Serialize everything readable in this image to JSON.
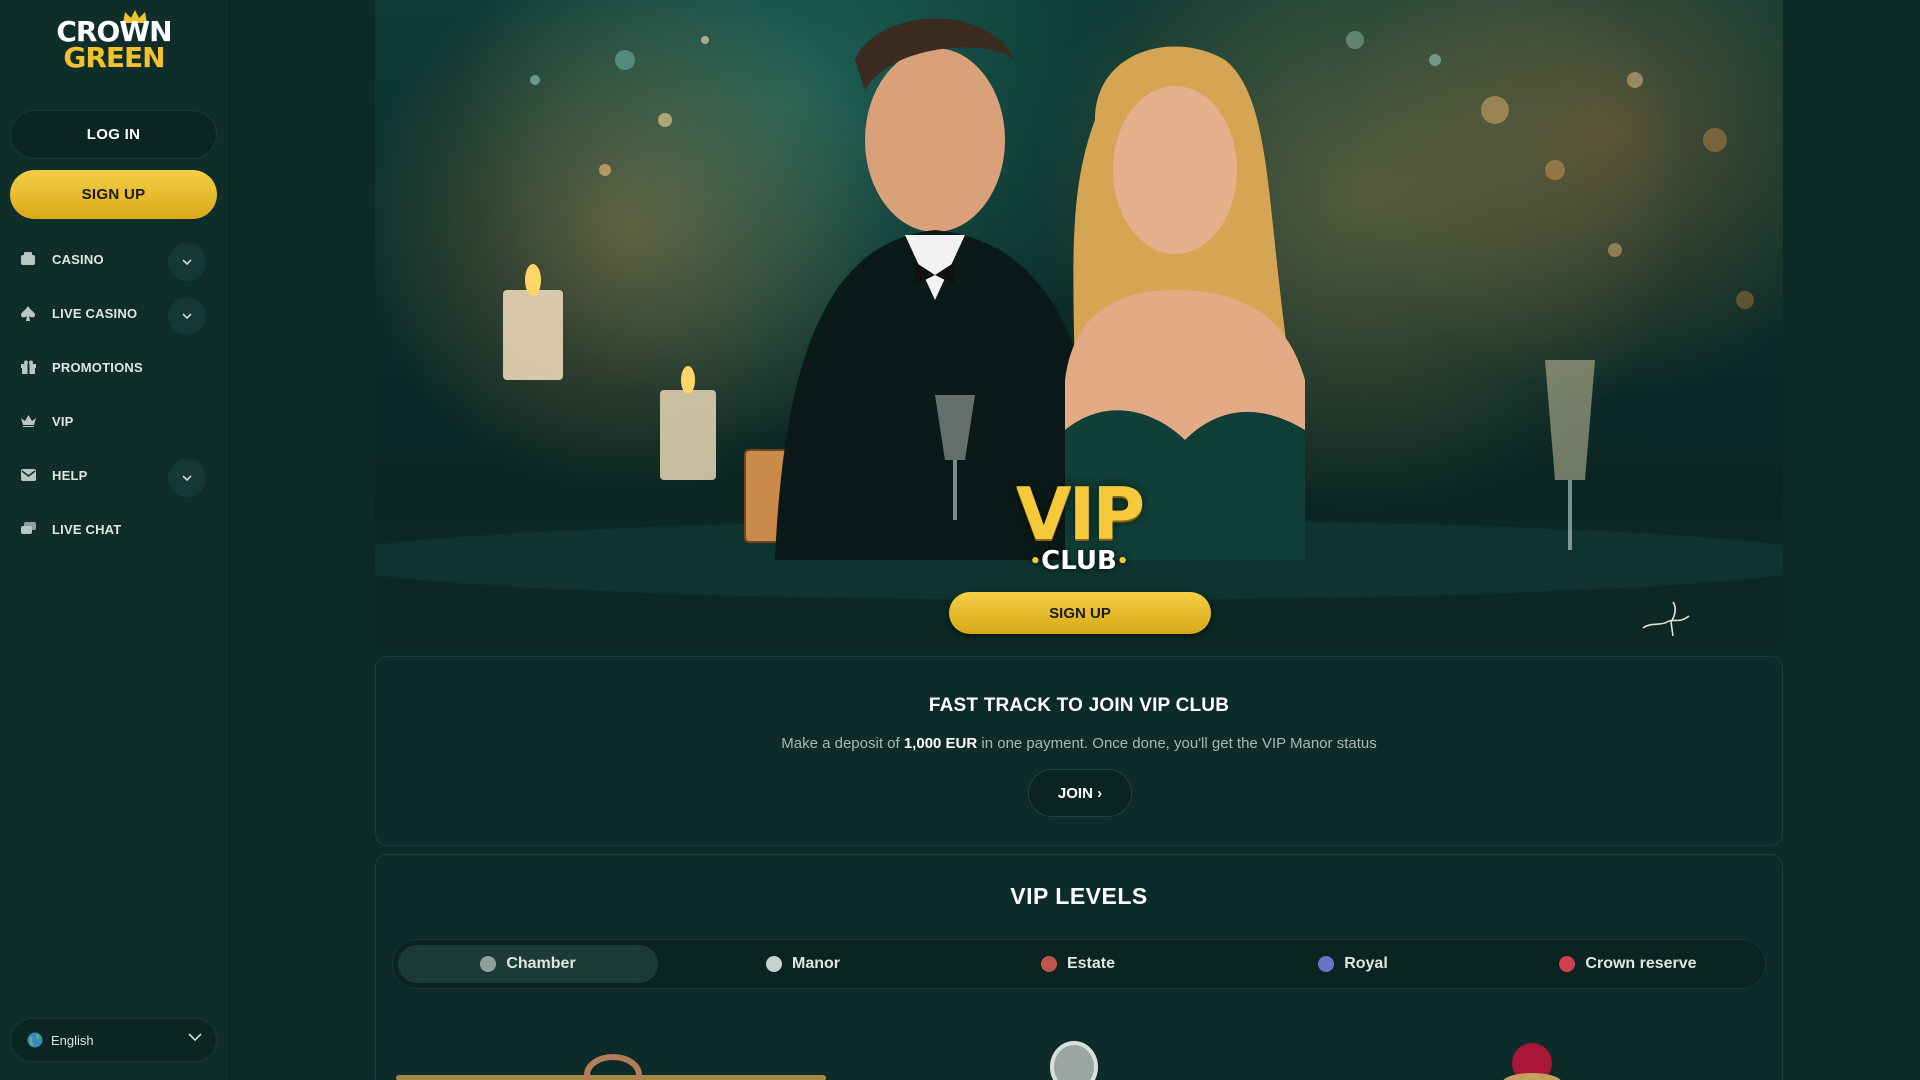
{
  "sidebar": {
    "logo": {
      "line1": "CROWN",
      "line2": "GREEN"
    },
    "login_label": "LOG IN",
    "signup_label": "SIGN UP",
    "items": [
      {
        "label": "CASINO",
        "icon": "casino-icon",
        "expandable": true
      },
      {
        "label": "LIVE CASINO",
        "icon": "spade-icon",
        "expandable": true
      },
      {
        "label": "PROMOTIONS",
        "icon": "gift-icon",
        "expandable": false
      },
      {
        "label": "VIP",
        "icon": "crown-icon",
        "expandable": false
      },
      {
        "label": "HELP",
        "icon": "mail-icon",
        "expandable": true
      },
      {
        "label": "LIVE CHAT",
        "icon": "chat-icon",
        "expandable": false
      }
    ],
    "language": "English"
  },
  "hero": {
    "vip_text": "VIP",
    "club_text": "CLUB",
    "signup_label": "SIGN UP"
  },
  "fast_track": {
    "title": "FAST TRACK TO JOIN VIP CLUB",
    "desc_prefix": "Make a deposit of ",
    "desc_amount": "1,000 EUR",
    "desc_suffix": " in one payment. Once done, you'll get the VIP Manor status",
    "join_label": "JOIN ›"
  },
  "vip_levels": {
    "title": "VIP LEVELS",
    "tabs": [
      {
        "label": "Chamber",
        "active": true,
        "color": "#8fa19b"
      },
      {
        "label": "Manor",
        "active": false,
        "color": "#c7d2cf"
      },
      {
        "label": "Estate",
        "active": false,
        "color": "#c0564a"
      },
      {
        "label": "Royal",
        "active": false,
        "color": "#6b73c9"
      },
      {
        "label": "Crown reserve",
        "active": false,
        "color": "#d0404e"
      }
    ]
  },
  "colors": {
    "accent_gold": "#f2c12e",
    "background": "#0c2a26",
    "sidebar": "#0f2e2a"
  }
}
